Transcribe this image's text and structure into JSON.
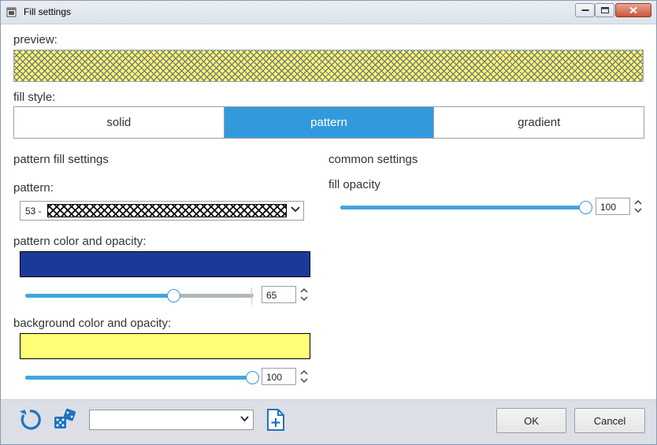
{
  "window": {
    "title": "Fill settings"
  },
  "preview": {
    "label": "preview:",
    "pattern_color": "#7a7a8a",
    "background_color": "#ffff66"
  },
  "fill_style": {
    "label": "fill style:",
    "options": [
      "solid",
      "pattern",
      "gradient"
    ],
    "selected": "pattern"
  },
  "pattern_settings": {
    "heading": "pattern fill settings",
    "pattern_label": "pattern:",
    "pattern_number": "53 -",
    "pattern_color_label": "pattern color and opacity:",
    "pattern_color": "#1a3a9a",
    "pattern_opacity": "65",
    "background_label": "background color and opacity:",
    "background_color": "#ffff77",
    "background_opacity": "100"
  },
  "common_settings": {
    "heading": "common settings",
    "fill_opacity_label": "fill opacity",
    "fill_opacity": "100"
  },
  "footer": {
    "preset_value": "",
    "ok_label": "OK",
    "cancel_label": "Cancel"
  },
  "colors": {
    "accent": "#3399dd",
    "slider": "#41a5de"
  }
}
